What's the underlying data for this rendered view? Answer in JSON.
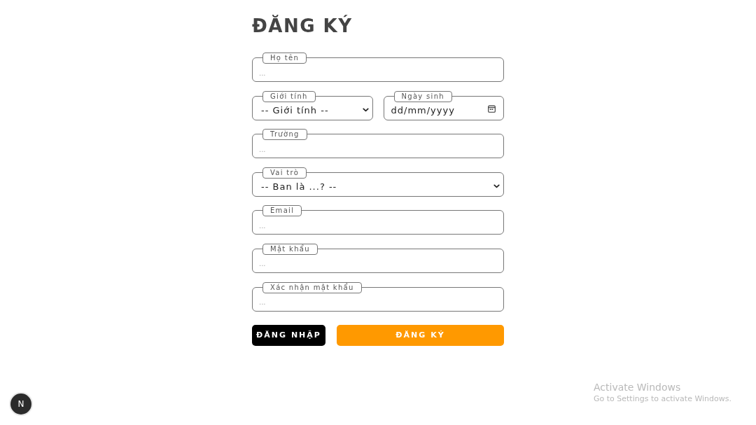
{
  "title": "ĐĂNG KÝ",
  "rows": [
    [
      {
        "kind": "text",
        "label": "Họ tên",
        "placeholder": "..."
      }
    ],
    [
      {
        "kind": "select",
        "label": "Giới tính",
        "value": "-- Giới tính --"
      },
      {
        "kind": "date",
        "label": "Ngày sinh",
        "placeholder": "dd/mm/yyyy"
      }
    ],
    [
      {
        "kind": "text",
        "label": "Trường",
        "placeholder": "..."
      }
    ],
    [
      {
        "kind": "select",
        "label": "Vai trò",
        "value": "-- Ban là ...? --"
      }
    ],
    [
      {
        "kind": "text",
        "label": "Email",
        "placeholder": "..."
      }
    ],
    [
      {
        "kind": "text",
        "label": "Mật khẩu",
        "placeholder": "..."
      }
    ],
    [
      {
        "kind": "text",
        "label": "Xác nhận mật khẩu",
        "placeholder": "..."
      }
    ]
  ],
  "buttons": [
    {
      "kind": "secondary",
      "label": "ĐĂNG NHẬP"
    },
    {
      "kind": "primary",
      "label": "ĐĂNG KÝ"
    }
  ],
  "dev_badge": {
    "label": "N"
  },
  "os_notice": {
    "title": "Activate Windows",
    "text": "Go to Settings to activate Windows."
  }
}
